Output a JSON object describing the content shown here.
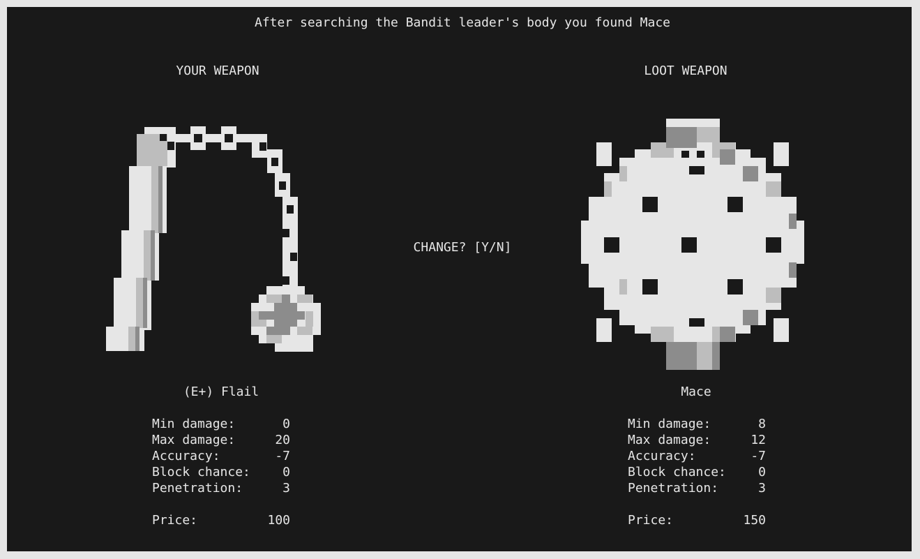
{
  "message": "After searching the Bandit leader's body you found Mace",
  "prompt": "CHANGE? [Y/N]",
  "colors": {
    "background": "#191919",
    "frame": "#e6e6e6",
    "text": "#e6e6e6",
    "pixel_light": "#e6e6e6",
    "pixel_mid": "#bdbdbd",
    "pixel_dark": "#8c8c8c"
  },
  "your_weapon": {
    "heading": "YOUR WEAPON",
    "name": "(E+) Flail",
    "icon": "flail-icon",
    "stats": [
      {
        "label": "Min damage:",
        "value": "0"
      },
      {
        "label": "Max damage:",
        "value": "20"
      },
      {
        "label": "Accuracy:",
        "value": "-7"
      },
      {
        "label": "Block chance:",
        "value": "0"
      },
      {
        "label": "Penetration:",
        "value": "3"
      }
    ],
    "price_label": "Price:",
    "price_value": "100"
  },
  "loot_weapon": {
    "heading": "LOOT WEAPON",
    "name": "Mace",
    "icon": "mace-icon",
    "stats": [
      {
        "label": "Min damage:",
        "value": "8"
      },
      {
        "label": "Max damage:",
        "value": "12"
      },
      {
        "label": "Accuracy:",
        "value": "-7"
      },
      {
        "label": "Block chance:",
        "value": "0"
      },
      {
        "label": "Penetration:",
        "value": "3"
      }
    ],
    "price_label": "Price:",
    "price_value": "150"
  }
}
